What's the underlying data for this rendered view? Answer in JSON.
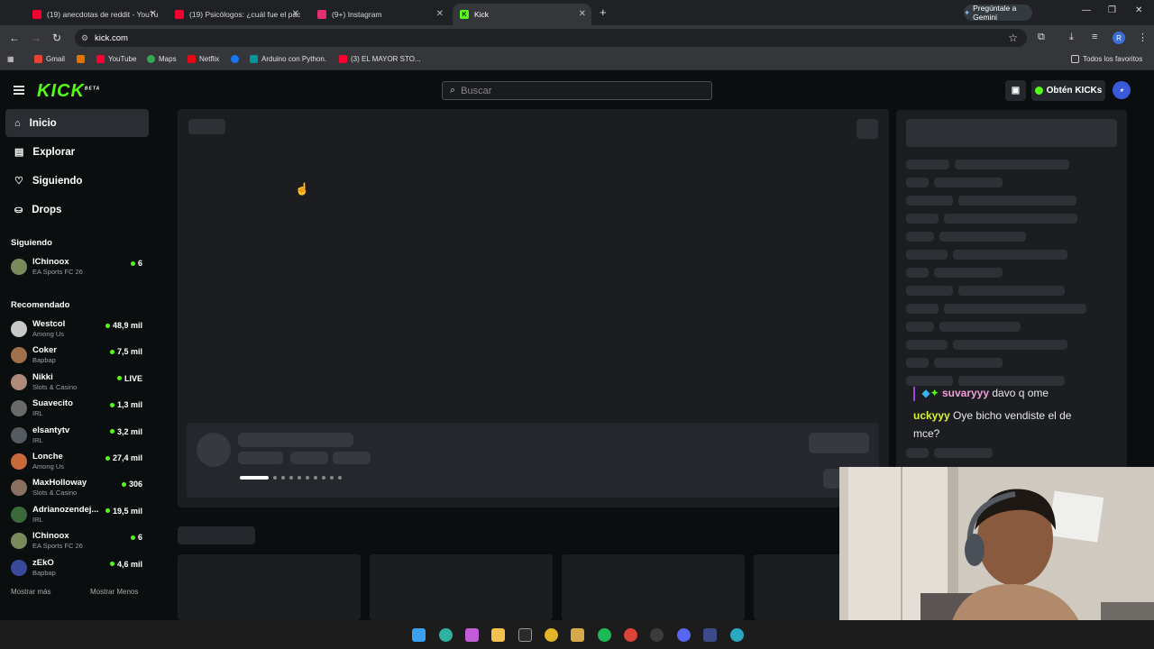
{
  "browser": {
    "tabs": [
      {
        "title": "(19) anecdotas de reddit - YouTu",
        "icon": "youtube-icon",
        "color": "#ff0033"
      },
      {
        "title": "(19) Psicólogos: ¿cuál fue el pac",
        "icon": "youtube-icon",
        "color": "#ff0033"
      },
      {
        "title": "(9+) Instagram",
        "icon": "instagram-icon",
        "color": "#e1306c"
      },
      {
        "title": "Kick",
        "icon": "kick-icon",
        "color": "#53fc18"
      }
    ],
    "gemini_label": "Pregúntale a Gemini",
    "url": "kick.com",
    "profile_initial": "R",
    "bookmarks": [
      "Gmail",
      "YouTube",
      "Maps",
      "Netflix",
      "Arduino con Python.",
      "(3) EL MAYOR STO..."
    ],
    "all_bookmarks_label": "Todos los favoritos"
  },
  "header": {
    "logo": "KICK",
    "logo_badge": "BETA",
    "search_placeholder": "Buscar",
    "get_kicks_label": "Obtén KICKs"
  },
  "sidebar": {
    "nav": [
      {
        "label": "Inicio",
        "icon": "home-icon"
      },
      {
        "label": "Explorar",
        "icon": "compass-icon"
      },
      {
        "label": "Siguiendo",
        "icon": "heart-icon"
      },
      {
        "label": "Drops",
        "icon": "drops-icon"
      }
    ],
    "following_title": "Siguiendo",
    "following": [
      {
        "name": "lChinoox",
        "game": "EA Sports FC 26",
        "viewers": "6",
        "avatar_color": "#7a8a5a"
      }
    ],
    "recommended_title": "Recomendado",
    "recommended": [
      {
        "name": "Westcol",
        "game": "Among Us",
        "viewers": "48,9 mil",
        "avatar_color": "#c8c8c8"
      },
      {
        "name": "Coker",
        "game": "Bapbap",
        "viewers": "7,5 mil",
        "avatar_color": "#a0704a"
      },
      {
        "name": "Nikki",
        "game": "Slots & Casino",
        "viewers": "LIVE",
        "avatar_color": "#b08a7a"
      },
      {
        "name": "Suavecito",
        "game": "IRL",
        "viewers": "1,3 mil",
        "avatar_color": "#6a6a6a"
      },
      {
        "name": "elsantytv",
        "game": "IRL",
        "viewers": "3,2 mil",
        "avatar_color": "#555a60"
      },
      {
        "name": "Lonche",
        "game": "Among Us",
        "viewers": "27,4 mil",
        "avatar_color": "#c86a3a"
      },
      {
        "name": "MaxHolloway",
        "game": "Slots & Casino",
        "viewers": "306",
        "avatar_color": "#8a7060"
      },
      {
        "name": "Adrianozendej...",
        "game": "IRL",
        "viewers": "19,5 mil",
        "avatar_color": "#3a6a3a"
      },
      {
        "name": "lChinoox",
        "game": "EA Sports FC 26",
        "viewers": "6",
        "avatar_color": "#7a8a5a"
      },
      {
        "name": "zEkO",
        "game": "Bapbap",
        "viewers": "4,6 mil",
        "avatar_color": "#3a4a9a"
      }
    ],
    "show_more": "Mostrar más",
    "show_less": "Mostrar Menos"
  },
  "chat": {
    "messages": [
      {
        "user": "suvaryyy",
        "user_color": "#f39ed8",
        "text": "davo q ome"
      },
      {
        "user": "uckyyy",
        "user_color": "#d7f536",
        "text": "Oye bicho vendiste el de mce?"
      }
    ]
  }
}
